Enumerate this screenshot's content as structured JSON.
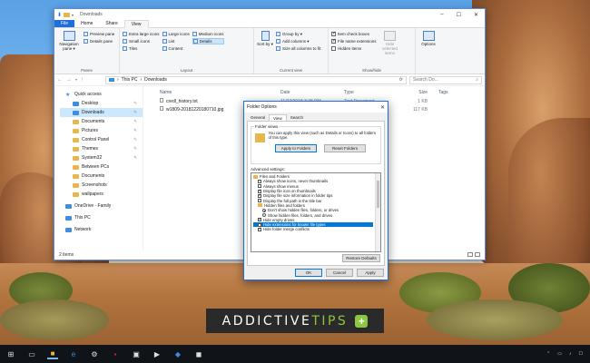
{
  "explorer": {
    "title": "Downloads",
    "tabs": [
      "File",
      "Home",
      "Share",
      "View"
    ],
    "active_tab": "View",
    "ribbon": {
      "panes": {
        "label": "Panes",
        "navigation_pane": "Navigation pane ▾",
        "preview_pane": "Preview pane",
        "details_pane": "Details pane"
      },
      "layout": {
        "label": "Layout",
        "items": [
          "Extra large icons",
          "Large icons",
          "Medium icons",
          "Small icons",
          "List",
          "Details",
          "Tiles",
          "Content"
        ],
        "selected": "Details"
      },
      "current_view": {
        "label": "Current view",
        "sort_by": "Sort by ▾",
        "group_by": "Group by ▾",
        "add_columns": "Add columns ▾",
        "size_columns": "Size all columns to fit"
      },
      "show_hide": {
        "label": "Show/hide",
        "item_check_boxes": "Item check boxes",
        "file_name_extensions": "File name extensions",
        "hidden_items": "Hidden items",
        "hide_selected": "Hide selected items"
      },
      "options": "Options"
    },
    "address": {
      "parts": [
        "This PC",
        "Downloads"
      ],
      "search_placeholder": "Search Do..."
    },
    "nav": [
      {
        "label": "Quick access",
        "type": "star",
        "level": 0
      },
      {
        "label": "Desktop",
        "type": "blue",
        "level": 1,
        "pinned": true
      },
      {
        "label": "Downloads",
        "type": "blue",
        "level": 1,
        "pinned": true,
        "selected": true
      },
      {
        "label": "Documents",
        "type": "folder",
        "level": 1,
        "pinned": true
      },
      {
        "label": "Pictures",
        "type": "folder",
        "level": 1,
        "pinned": true
      },
      {
        "label": "Control Panel",
        "type": "folder",
        "level": 1,
        "pinned": true
      },
      {
        "label": "Themes",
        "type": "folder",
        "level": 1,
        "pinned": true
      },
      {
        "label": "System32",
        "type": "folder",
        "level": 1,
        "pinned": true
      },
      {
        "label": "Between PCs",
        "type": "folder",
        "level": 1
      },
      {
        "label": "Documents",
        "type": "folder",
        "level": 1
      },
      {
        "label": "Screenshots",
        "type": "folder",
        "level": 1
      },
      {
        "label": "wallpapers",
        "type": "folder",
        "level": 1
      },
      {
        "label": "OneDrive - Family",
        "type": "blue",
        "level": 0
      },
      {
        "label": "This PC",
        "type": "blue",
        "level": 0
      },
      {
        "label": "Network",
        "type": "blue",
        "level": 0
      }
    ],
    "columns": [
      "Name",
      "Date",
      "Type",
      "Size",
      "Tags"
    ],
    "files": [
      {
        "name": "credl_history.txt",
        "date": "11/27/2018 3:38 PM",
        "type": "Text Document",
        "size": "1 KB"
      },
      {
        "name": "w1809-20181220180710.jpg",
        "date": "",
        "type": "",
        "size": "117 KB"
      }
    ],
    "status": "2 items"
  },
  "dialog": {
    "title": "Folder Options",
    "tabs": [
      "General",
      "View",
      "Search"
    ],
    "active_tab": "View",
    "folder_views": {
      "legend": "Folder views",
      "description": "You can apply this view (such as Details or Icons) to all folders of this type.",
      "apply": "Apply to Folders",
      "reset": "Reset Folders"
    },
    "advanced_label": "Advanced settings:",
    "advanced": [
      {
        "label": "Files and Folders",
        "kind": "folder",
        "level": 0
      },
      {
        "label": "Always show icons, never thumbnails",
        "kind": "check",
        "on": false,
        "level": 1
      },
      {
        "label": "Always show menus",
        "kind": "check",
        "on": false,
        "level": 1
      },
      {
        "label": "Display file icon on thumbnails",
        "kind": "check",
        "on": true,
        "level": 1
      },
      {
        "label": "Display file size information in folder tips",
        "kind": "check",
        "on": true,
        "level": 1
      },
      {
        "label": "Display the full path in the title bar",
        "kind": "check",
        "on": false,
        "level": 1
      },
      {
        "label": "Hidden files and folders",
        "kind": "folder",
        "level": 1
      },
      {
        "label": "Don't show hidden files, folders, or drives",
        "kind": "radio",
        "on": true,
        "level": 2
      },
      {
        "label": "Show hidden files, folders, and drives",
        "kind": "radio",
        "on": false,
        "level": 2
      },
      {
        "label": "Hide empty drives",
        "kind": "check",
        "on": true,
        "level": 1
      },
      {
        "label": "Hide extensions for known file types",
        "kind": "check",
        "on": false,
        "level": 1,
        "highlight": true
      },
      {
        "label": "Hide folder merge conflicts",
        "kind": "check",
        "on": true,
        "level": 1
      }
    ],
    "restore": "Restore Defaults",
    "ok": "OK",
    "cancel": "Cancel",
    "apply": "Apply"
  },
  "watermark": {
    "text_main": "ADDICTIVE",
    "text_accent": "TIPS",
    "plus": "+"
  }
}
